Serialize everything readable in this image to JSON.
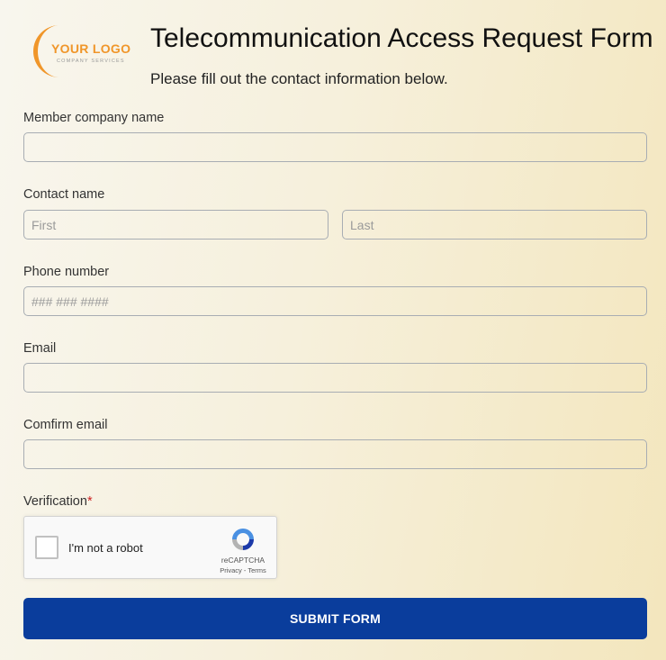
{
  "logo": {
    "text": "YOUR LOGO",
    "subtext": "COMPANY SERVICES"
  },
  "header": {
    "title": "Telecommunication Access Request Form",
    "subtitle": "Please fill out the contact information below."
  },
  "form": {
    "member_company": {
      "label": "Member company name",
      "value": "",
      "placeholder": ""
    },
    "contact_name": {
      "label": "Contact name",
      "first_placeholder": "First",
      "last_placeholder": "Last"
    },
    "phone": {
      "label": "Phone number",
      "placeholder": "### ### ####"
    },
    "email": {
      "label": "Email",
      "placeholder": ""
    },
    "confirm_email": {
      "label": "Comfirm email",
      "placeholder": ""
    },
    "verification": {
      "label": "Verification",
      "required_mark": "*",
      "captcha_text": "I'm not a robot",
      "captcha_brand": "reCAPTCHA",
      "captcha_terms": "Privacy - Terms",
      "checked": false
    },
    "submit_label": "SUBMIT FORM"
  },
  "colors": {
    "accent": "#0a3d9c",
    "logo_orange": "#f0962a",
    "required": "#cc2222"
  },
  "icons": [
    "logo-crescent-icon",
    "recaptcha-icon",
    "checkbox-icon"
  ]
}
